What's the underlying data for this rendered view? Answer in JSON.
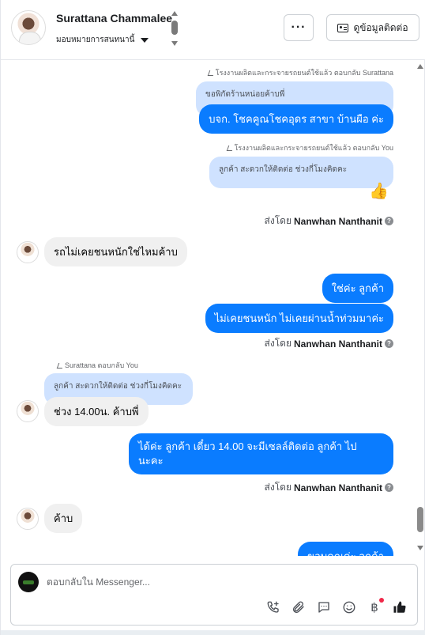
{
  "header": {
    "contact_name": "Surattana Chammalee",
    "assignment_label": "มอบหมายการสนทนานี้",
    "more_label": "···",
    "contact_info_label": "ดูข้อมูลติดต่อ"
  },
  "messages": {
    "reply_note_1": "โรงงานผลิตและกระจายรถยนต์ใช้แล้ว ตอบกลับ Surattana",
    "quoted_1": "ขอพิกัดร้านหน่อยค้าบพี่",
    "out_1": "บจก. โชคคูณโชคอุดร สาขา บ้านผือ ค่ะ",
    "reply_note_2": "โรงงานผลิตและกระจายรถยนต์ใช้แล้ว ตอบกลับ You",
    "quoted_2": "ลูกค้า สะดวกให้ติดต่อ ช่วงกี่โมงคิดคะ",
    "like_reaction": "👍",
    "sent_by_prefix_1": "ส่งโดย",
    "sent_by_name_1": "Nanwhan Nanthanit",
    "in_1": "รถไม่เคยชนหนักใช่ไหมค้าบ",
    "out_2": "ใช่ค่ะ  ลูกค้า",
    "out_3": "ไม่เคยชนหนัก ไม่เคยผ่านน้ำท่วมมาค่ะ",
    "sent_by_prefix_2": "ส่งโดย",
    "sent_by_name_2": "Nanwhan Nanthanit",
    "reply_note_3": "Surattana ตอบกลับ You",
    "quoted_3": "ลูกค้า สะดวกให้ติดต่อ ช่วงกี่โมงคิดคะ",
    "in_2": "ช่วง 14.00น. ค้าบพี่",
    "out_4_line1": "ได้ค่ะ  ลูกค้า  เดี๋ยว   14.00 จะมีเซลล์ติดต่อ ลูกค้า  ไป",
    "out_4_line2": "นะคะ",
    "sent_by_prefix_3": "ส่งโดย",
    "sent_by_name_3": "Nanwhan Nanthanit",
    "in_3": "ค้าบ",
    "out_5_partial": "ขอบคุณค่ะ  ลูกค้า"
  },
  "composer": {
    "placeholder": "ตอบกลับใน Messenger...",
    "currency_glyph": "฿"
  },
  "icons": {
    "call": "phone-plus-icon",
    "attach": "paperclip-icon",
    "saved_replies": "chat-bubble-icon",
    "emoji": "emoji-icon",
    "payment": "baht-icon",
    "like": "thumbs-up-icon"
  },
  "colors": {
    "outgoing_bubble": "#0a7cff",
    "quoted_bubble": "#cfe2ff",
    "incoming_bubble": "#f0f0f0"
  }
}
